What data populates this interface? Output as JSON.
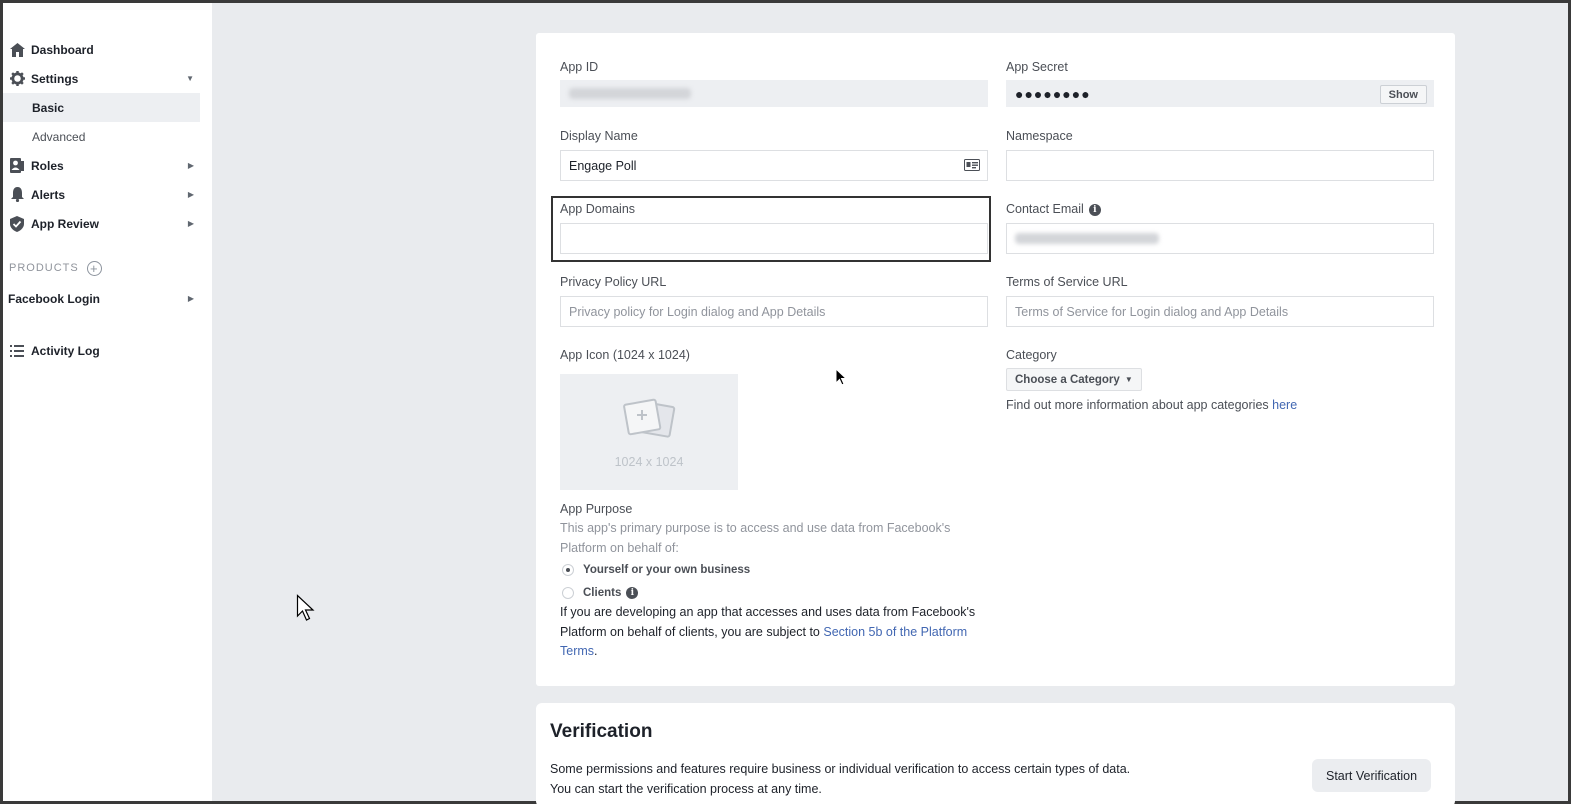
{
  "sidebar": {
    "dashboard": "Dashboard",
    "settings": "Settings",
    "basic": "Basic",
    "advanced": "Advanced",
    "roles": "Roles",
    "alerts": "Alerts",
    "app_review": "App Review",
    "products_label": "PRODUCTS",
    "facebook_login": "Facebook Login",
    "activity_log": "Activity Log"
  },
  "form": {
    "app_id_label": "App ID",
    "app_secret_label": "App Secret",
    "app_secret_value": "●●●●●●●●",
    "show_button": "Show",
    "display_name_label": "Display Name",
    "display_name_value": "Engage Poll",
    "namespace_label": "Namespace",
    "app_domains_label": "App Domains",
    "contact_email_label": "Contact Email",
    "privacy_label": "Privacy Policy URL",
    "privacy_placeholder": "Privacy policy for Login dialog and App Details",
    "tos_label": "Terms of Service URL",
    "tos_placeholder": "Terms of Service for Login dialog and App Details",
    "app_icon_label": "App Icon (1024 x 1024)",
    "app_icon_size": "1024 x 1024",
    "category_label": "Category",
    "category_button": "Choose a Category",
    "category_info_text": "Find out more information about app categories",
    "category_info_link": "here",
    "purpose_label": "App Purpose",
    "purpose_desc": "This app's primary purpose is to access and use data from Facebook's Platform on behalf of:",
    "option_yourself": "Yourself or your own business",
    "option_clients": "Clients",
    "note_text": "If you are developing an app that accesses and uses data from Facebook's Platform on behalf of clients, you are subject to",
    "note_link": "Section 5b of the Platform Terms",
    "note_end": "."
  },
  "verification": {
    "title": "Verification",
    "description": "Some permissions and features require business or individual verification to access certain types of data. You can start the verification process at any time.",
    "button": "Start Verification"
  },
  "colors": {
    "background": "#e9ebee",
    "link": "#4267b2",
    "text": "#1d2129"
  }
}
